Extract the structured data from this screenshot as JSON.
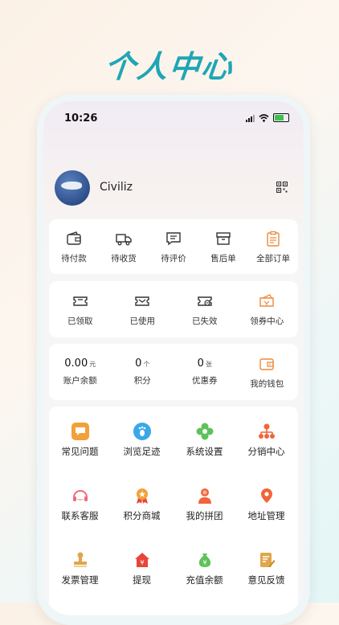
{
  "promo": {
    "title": "个人中心"
  },
  "status": {
    "time": "10:26"
  },
  "profile": {
    "username": "Civiliz"
  },
  "orders": [
    {
      "label": "待付款",
      "icon": "wallet-icon"
    },
    {
      "label": "待收货",
      "icon": "truck-icon"
    },
    {
      "label": "待评价",
      "icon": "comment-icon"
    },
    {
      "label": "售后单",
      "icon": "box-icon"
    },
    {
      "label": "全部订单",
      "icon": "clipboard-icon"
    }
  ],
  "coupons": [
    {
      "label": "已领取",
      "icon": "ticket-icon"
    },
    {
      "label": "已使用",
      "icon": "ticket-used-icon"
    },
    {
      "label": "已失效",
      "icon": "ticket-expired-icon"
    },
    {
      "label": "领券中心",
      "icon": "coupon-center-icon"
    }
  ],
  "assets": [
    {
      "value": "0.00",
      "unit": "元",
      "label": "账户余额"
    },
    {
      "value": "0",
      "unit": "个",
      "label": "积分"
    },
    {
      "value": "0",
      "unit": "张",
      "label": "优惠券"
    }
  ],
  "wallet": {
    "label": "我的钱包",
    "icon": "wallet-icon"
  },
  "services": [
    {
      "label": "常见问题",
      "icon": "chat-icon",
      "color": "#f2a13a"
    },
    {
      "label": "浏览足迹",
      "icon": "footprint-icon",
      "color": "#3aa8e8"
    },
    {
      "label": "系统设置",
      "icon": "flower-icon",
      "color": "#5ec25a"
    },
    {
      "label": "分销中心",
      "icon": "org-icon",
      "color": "#f0653a"
    },
    {
      "label": "联系客服",
      "icon": "headset-icon",
      "color": "#f06a7a"
    },
    {
      "label": "积分商城",
      "icon": "medal-icon",
      "color": "#f2a13a"
    },
    {
      "label": "我的拼团",
      "icon": "group-icon",
      "color": "#f0653a"
    },
    {
      "label": "地址管理",
      "icon": "location-icon",
      "color": "#f0653a"
    },
    {
      "label": "发票管理",
      "icon": "stamp-icon",
      "color": "#e0a64c"
    },
    {
      "label": "提现",
      "icon": "house-yen-icon",
      "color": "#e8453a"
    },
    {
      "label": "充值余额",
      "icon": "money-bag-icon",
      "color": "#5ec25a"
    },
    {
      "label": "意见反馈",
      "icon": "feedback-icon",
      "color": "#e0a64c"
    }
  ]
}
